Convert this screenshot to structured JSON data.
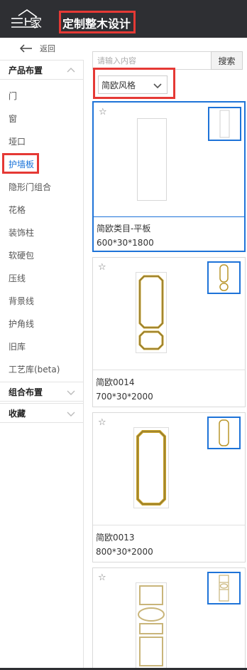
{
  "header": {
    "logo_text": "家",
    "app_title": "定制整木设计"
  },
  "nav": {
    "back_label": "返回"
  },
  "sidebar": {
    "groups": [
      {
        "label": "产品布置",
        "expanded": true
      },
      {
        "label": "组合布置",
        "expanded": false
      },
      {
        "label": "收藏",
        "expanded": false
      }
    ],
    "items": [
      {
        "label": "门"
      },
      {
        "label": "窗"
      },
      {
        "label": "垭口"
      },
      {
        "label": "护墙板",
        "active": true
      },
      {
        "label": "隐形门组合"
      },
      {
        "label": "花格"
      },
      {
        "label": "装饰柱"
      },
      {
        "label": "软硬包"
      },
      {
        "label": "压线"
      },
      {
        "label": "背景线"
      },
      {
        "label": "护角线"
      },
      {
        "label": "旧库"
      },
      {
        "label": "工艺库(beta)"
      }
    ]
  },
  "search": {
    "placeholder": "请输入内容",
    "button_label": "搜索"
  },
  "filter": {
    "selected_style": "简欧风格"
  },
  "products": [
    {
      "name": "简欧类目-平板",
      "size": "600*30*1800",
      "selected": true
    },
    {
      "name": "简欧0014",
      "size": "700*30*2000",
      "selected": false
    },
    {
      "name": "简欧0013",
      "size": "800*30*2000",
      "selected": false
    },
    {
      "name": "",
      "size": "",
      "selected": false
    }
  ],
  "colors": {
    "header_bg": "#2e2f33",
    "accent_blue": "#1e73d8",
    "highlight_red": "#e53935",
    "moulding_gold": "#c9a227"
  },
  "icons": {
    "back": "arrow-left-icon",
    "expand": "chevron-icon",
    "favorite": "star-outline-icon"
  }
}
